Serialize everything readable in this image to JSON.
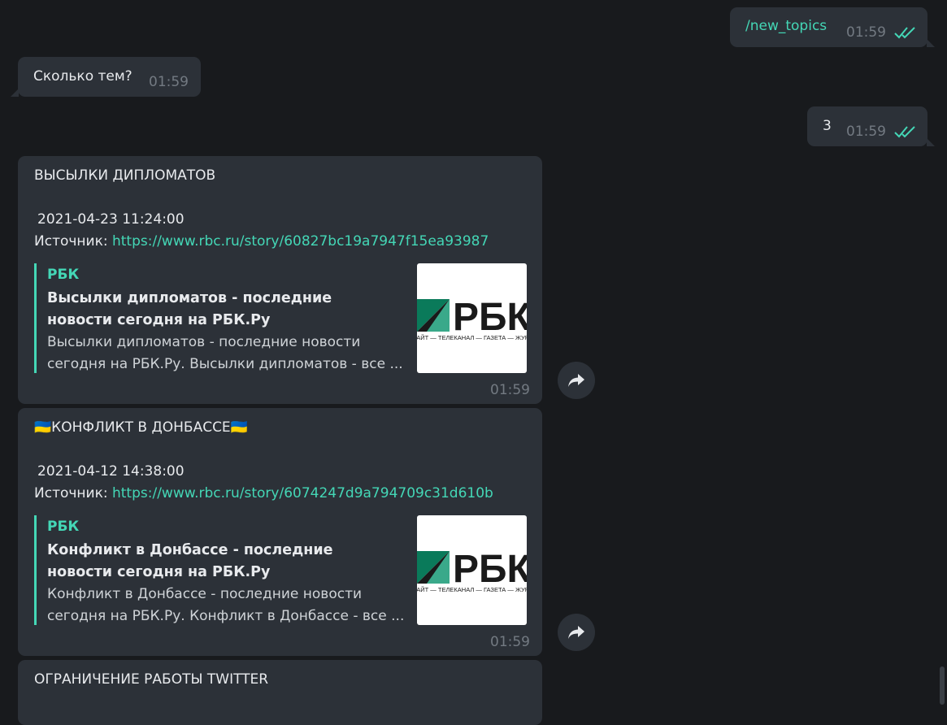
{
  "messages": {
    "m1": {
      "text": "/new_topics",
      "time": "01:59"
    },
    "m2": {
      "text": "Сколько тем?",
      "time": "01:59"
    },
    "m3": {
      "text": "3",
      "time": "01:59"
    }
  },
  "cards": [
    {
      "title": "ВЫСЫЛКИ ДИПЛОМАТОВ",
      "date": "2021-04-23 11:24:00",
      "source_label": "Источник: ",
      "url": "https://www.rbc.ru/story/60827bc19a7947f15ea93987",
      "preview": {
        "site": "РБК",
        "headline": "Высылки дипломатов - последние новости сегодня на РБК.Ру",
        "description": "Высылки дипломатов - последние новости сегодня на РБК.Ру. Высылки дипломатов - все ...",
        "logo_text": "РБК",
        "logo_tagline": "САЙТ — ТЕЛЕКАНАЛ — ГАЗЕТА — ЖУРНАЛ"
      },
      "time": "01:59"
    },
    {
      "title": "🇺🇦КОНФЛИКТ В ДОНБАССЕ🇺🇦",
      "date": "2021-04-12 14:38:00",
      "source_label": "Источник: ",
      "url": "https://www.rbc.ru/story/6074247d9a794709c31d610b",
      "preview": {
        "site": "РБК",
        "headline": "Конфликт в Донбассе - последние новости сегодня на РБК.Ру",
        "description": "Конфликт в Донбассе - последние новости сегодня на РБК.Ру. Конфликт в Донбассе - все ...",
        "logo_text": "РБК",
        "logo_tagline": "САЙТ — ТЕЛЕКАНАЛ — ГАЗЕТА — ЖУРНАЛ"
      },
      "time": "01:59"
    },
    {
      "title": "ОГРАНИЧЕНИЕ РАБОТЫ TWITTER"
    }
  ],
  "icons": {
    "share": "share-arrow-icon",
    "read": "double-check-icon"
  },
  "colors": {
    "background": "#181a1d",
    "bubble": "#2c3138",
    "accent": "#44d7b6",
    "muted": "#737a82"
  }
}
